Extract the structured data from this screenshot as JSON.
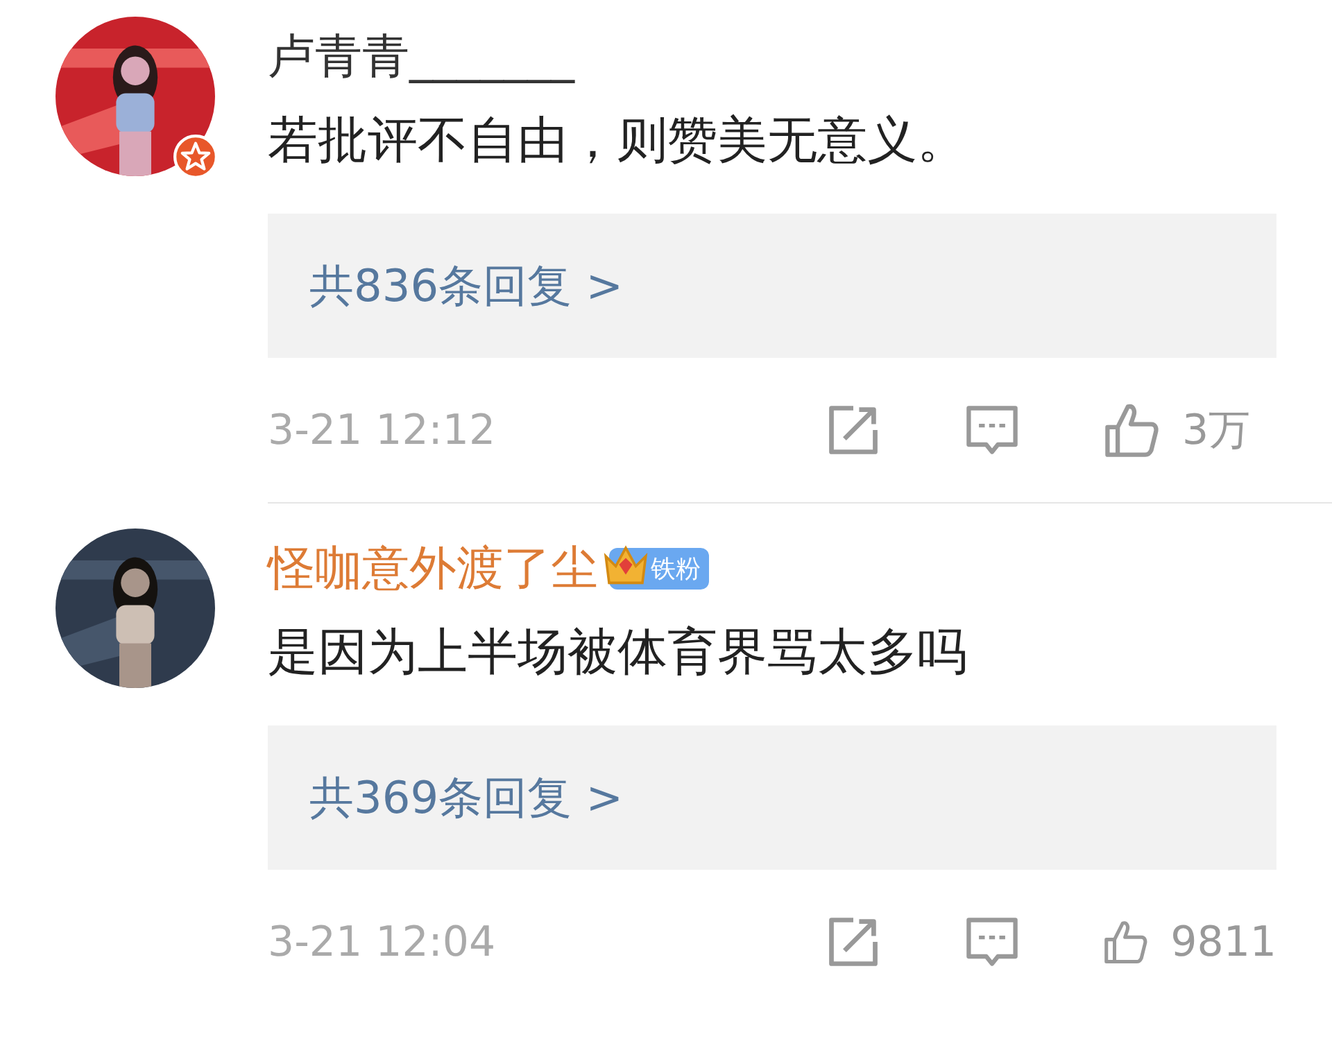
{
  "comments": [
    {
      "name": "卢青青_______",
      "vip": false,
      "badge": {
        "kind": "verified"
      },
      "text": "若批评不自由，则赞美无意义。",
      "replies": "共836条回复 >",
      "time": "3-21 12:12",
      "likes": "3万"
    },
    {
      "name": "怪咖意外渡了尘",
      "vip": true,
      "badge": {
        "kind": "fan",
        "label": "铁粉"
      },
      "text": "是因为上半场被体育界骂太多吗",
      "replies": "共369条回复 >",
      "time": "3-21 12:04",
      "likes": "9811"
    }
  ]
}
